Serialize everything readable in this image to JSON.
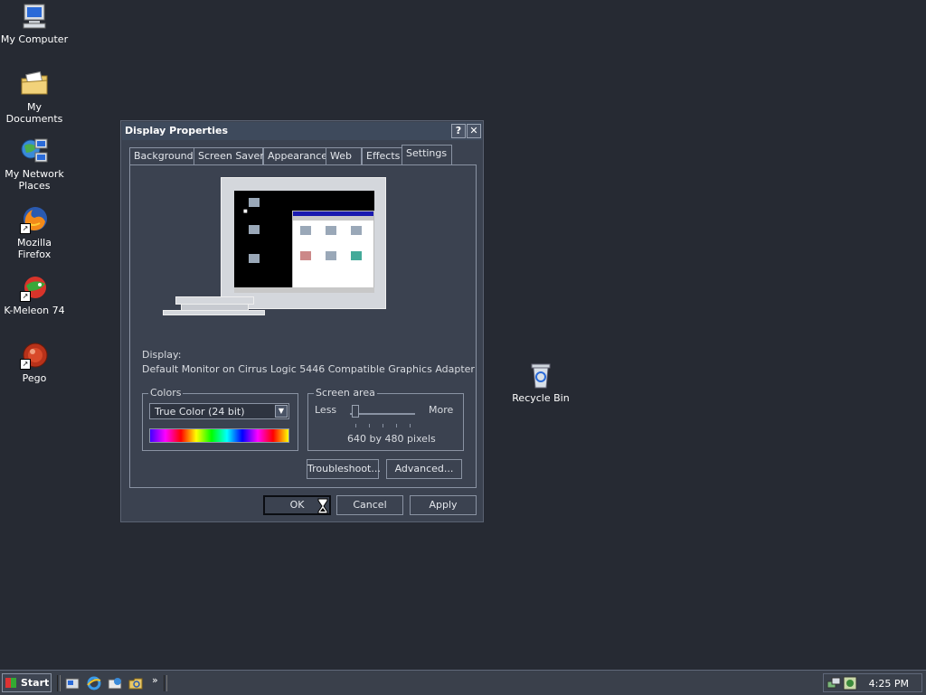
{
  "desktop": {
    "icons": [
      {
        "label": "My Computer",
        "icon": "my-computer-icon"
      },
      {
        "label": "My Documents",
        "icon": "my-documents-icon"
      },
      {
        "label_line1": "My Network",
        "label_line2": "Places",
        "icon": "network-places-icon"
      },
      {
        "label": "Mozilla Firefox",
        "icon": "firefox-icon"
      },
      {
        "label": "K-Meleon 74",
        "icon": "k-meleon-icon"
      },
      {
        "label": "Pego",
        "icon": "pego-icon"
      },
      {
        "label": "Recycle Bin",
        "icon": "recycle-bin-icon"
      }
    ]
  },
  "dialog": {
    "title": "Display Properties",
    "help_glyph": "?",
    "close_glyph": "✕",
    "tabs": [
      "Background",
      "Screen Saver",
      "Appearance",
      "Web",
      "Effects",
      "Settings"
    ],
    "active_tab": "Settings",
    "display_label": "Display:",
    "display_value": "Default Monitor on Cirrus Logic 5446 Compatible Graphics Adapter",
    "colors": {
      "group_label": "Colors",
      "selected": "True Color (24 bit)"
    },
    "screen_area": {
      "group_label": "Screen area",
      "less_label": "Less",
      "more_label": "More",
      "resolution": "640 by 480 pixels",
      "slider_position": 0
    },
    "buttons": {
      "troubleshoot": "Troubleshoot...",
      "advanced": "Advanced...",
      "ok": "OK",
      "cancel": "Cancel",
      "apply": "Apply"
    }
  },
  "taskbar": {
    "start_label": "Start",
    "overflow_glyph": "»",
    "clock": "4:25 PM"
  },
  "colors": {
    "desktop_bg": "#262a33",
    "dialog_bg": "#3b4250",
    "taskbar_bg": "#3a404b"
  }
}
